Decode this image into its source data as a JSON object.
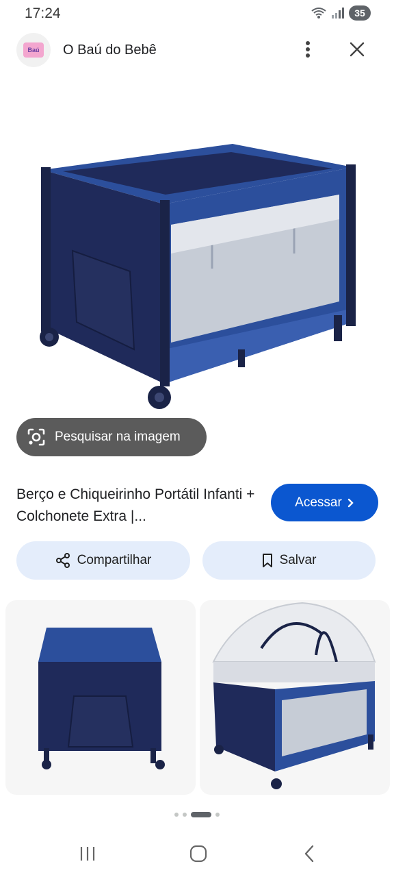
{
  "status_bar": {
    "time": "17:24",
    "battery": "35",
    "icons": [
      "wifi-icon",
      "signal-icon",
      "battery-icon"
    ]
  },
  "header": {
    "site_name": "O Baú do Bebê",
    "logo_text": "Baú",
    "icons": [
      "site-logo",
      "more-vert-icon",
      "close-icon"
    ]
  },
  "lens": {
    "label": "Pesquisar na imagem",
    "icon": "lens-icon"
  },
  "result": {
    "title": "Berço e Chiqueirinho Portátil Infanti + Colchonete Extra |...",
    "visit_label": "Acessar",
    "visit_icon": "chevron-right-icon"
  },
  "actions": {
    "share_label": "Compartilhar",
    "save_label": "Salvar",
    "share_icon": "share-icon",
    "save_icon": "bookmark-icon"
  },
  "pager": {
    "count": 4,
    "active": 2
  },
  "colors": {
    "accent": "#0b57d0",
    "chip_bg": "#e4edfb",
    "lens_bg": "#5b5b5b",
    "crib_blue": "#2c4f9c",
    "crib_navy": "#1f2a5a"
  },
  "nav": {
    "icons": [
      "recents-icon",
      "home-icon",
      "back-icon"
    ]
  }
}
